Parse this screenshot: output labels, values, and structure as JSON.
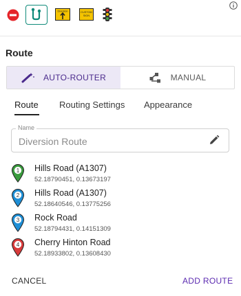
{
  "toolbar": {
    "items": [
      {
        "icon": "no-entry-icon",
        "color": "#e5252a"
      },
      {
        "icon": "route-icon",
        "color": "#0f8a7a",
        "selected": true
      },
      {
        "icon": "diversion-sign-icon",
        "text": "Diversion"
      },
      {
        "icon": "custom-sign-icon",
        "text": "CUSTOM SIGN"
      },
      {
        "icon": "traffic-light-icon"
      }
    ],
    "info_icon": "info-icon"
  },
  "section": {
    "title": "Route"
  },
  "mode": {
    "auto": {
      "label": "AUTO-ROUTER",
      "icon": "magic-wand-icon",
      "active": true
    },
    "manual": {
      "label": "MANUAL",
      "icon": "route-nodes-icon",
      "active": false
    }
  },
  "tabs": [
    {
      "label": "Route",
      "active": true
    },
    {
      "label": "Routing Settings",
      "active": false
    },
    {
      "label": "Appearance",
      "active": false
    }
  ],
  "name_field": {
    "label": "Name",
    "value": "Diversion Route",
    "icon": "pencil-icon"
  },
  "waypoints": [
    {
      "index": "1",
      "name": "Hills Road (A1307)",
      "coords": "52.18790451, 0.13673197",
      "color": "#3a9b3e"
    },
    {
      "index": "2",
      "name": "Hills Road (A1307)",
      "coords": "52.18640546, 0.13775256",
      "color": "#1f8fd6"
    },
    {
      "index": "3",
      "name": "Rock Road",
      "coords": "52.18794431, 0.14151309",
      "color": "#1f8fd6"
    },
    {
      "index": "4",
      "name": "Cherry Hinton Road",
      "coords": "52.18933802, 0.13608430",
      "color": "#d83b3b"
    }
  ],
  "actions": {
    "cancel": "CANCEL",
    "add": "ADD ROUTE"
  },
  "colors": {
    "accent": "#5b2ab0",
    "accent_bg": "#ece8f6"
  }
}
